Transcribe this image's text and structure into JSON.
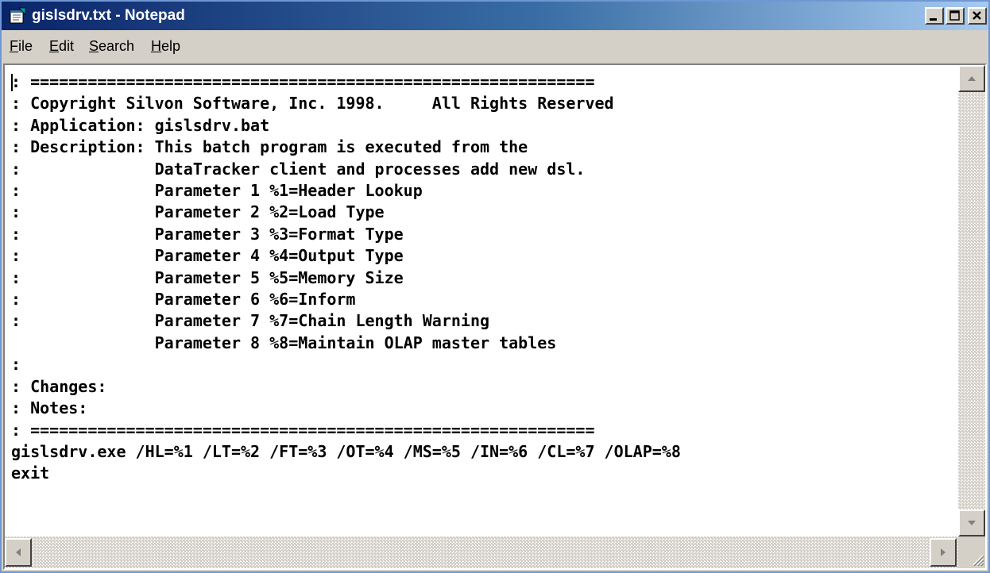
{
  "window": {
    "title": "gislsdrv.txt - Notepad"
  },
  "menu": {
    "file": {
      "accel": "F",
      "rest": "ile"
    },
    "edit": {
      "accel": "E",
      "rest": "dit"
    },
    "search": {
      "accel": "S",
      "rest": "earch"
    },
    "help": {
      "accel": "H",
      "rest": "elp"
    }
  },
  "icons": {
    "app": "notepad-icon",
    "minimize": "minimize-icon",
    "maximize": "maximize-icon",
    "close": "close-icon",
    "scroll_up": "arrow-up-icon",
    "scroll_down": "arrow-down-icon",
    "scroll_left": "arrow-left-icon",
    "scroll_right": "arrow-right-icon",
    "size_grip": "size-grip-icon"
  },
  "colors": {
    "title_start": "#0a246a",
    "title_end": "#a6caf0",
    "face": "#d4d0c8"
  },
  "document": {
    "content": ": ===========================================================\n: Copyright Silvon Software, Inc. 1998.     All Rights Reserved\n: Application: gislsdrv.bat\n: Description: This batch program is executed from the\n:              DataTracker client and processes add new dsl.\n:              Parameter 1 %1=Header Lookup\n:              Parameter 2 %2=Load Type\n:              Parameter 3 %3=Format Type\n:              Parameter 4 %4=Output Type\n:              Parameter 5 %5=Memory Size\n:              Parameter 6 %6=Inform\n:              Parameter 7 %7=Chain Length Warning\n               Parameter 8 %8=Maintain OLAP master tables\n:\n: Changes:\n: Notes:\n: ===========================================================\ngislsdrv.exe /HL=%1 /LT=%2 /FT=%3 /OT=%4 /MS=%5 /IN=%6 /CL=%7 /OLAP=%8\nexit"
  }
}
